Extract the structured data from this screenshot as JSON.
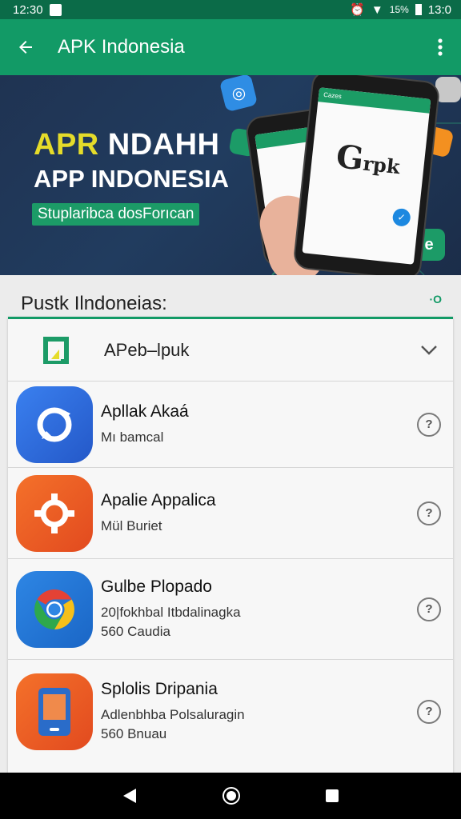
{
  "status_bar": {
    "time_left": "12:30",
    "battery_pct": "15%",
    "time_right": "13:0"
  },
  "toolbar": {
    "title": "APK Indonesia"
  },
  "banner": {
    "headline_accent": "APR",
    "headline_rest": " NDAHH",
    "subheadline": "APP INDONESIA",
    "pill": "Stuplaribca dosForıcan",
    "phone_logo": "G",
    "phone_logo_small": "rpk",
    "phone_bar_text": "Cazes"
  },
  "section": {
    "title": "Pustk Ilndoneias:",
    "action": "·O"
  },
  "dropdown": {
    "label": "APeb–lpuk"
  },
  "apps": [
    {
      "name": "Apllak Akaá",
      "sub1": "Mı bamcal",
      "sub2": "",
      "color": "#2f6fe0"
    },
    {
      "name": "Apalie Appalica",
      "sub1": "Mül Buriet",
      "sub2": "",
      "color": "#ef5a25"
    },
    {
      "name": "Gulbe Plopado",
      "sub1": "20|fokhbal Itbdalinagka",
      "sub2": "560 Caudia",
      "color": "#2176d9"
    },
    {
      "name": "Splolis Dripania",
      "sub1": "Adlenbhba Polsaluragin",
      "sub2": "560 Bnuau",
      "color": "#ef5a25"
    }
  ],
  "help_glyph": "?",
  "colors": {
    "primary": "#129a66",
    "primary_dark": "#0b6b48",
    "banner_bg": "#213c5f",
    "accent_yellow": "#e5dc2a"
  }
}
